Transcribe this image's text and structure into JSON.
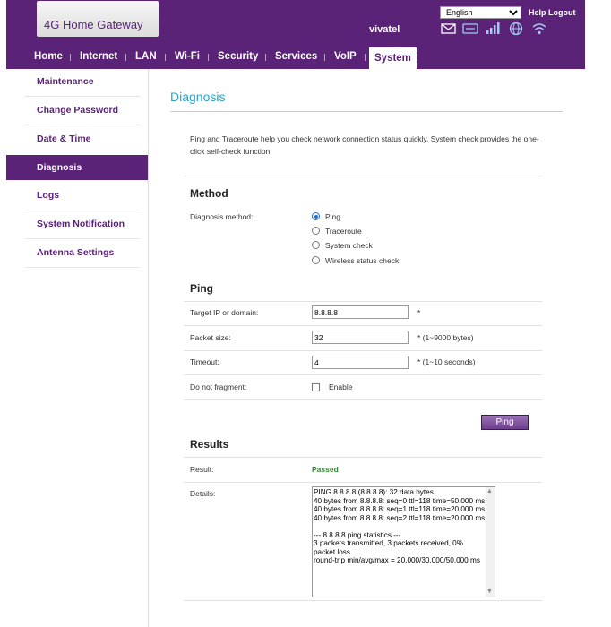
{
  "header": {
    "logo": "4G Home Gateway",
    "brand": "vivatel",
    "language": "English",
    "help": "Help",
    "logout": "Logout"
  },
  "nav": [
    "Home",
    "Internet",
    "LAN",
    "Wi-Fi",
    "Security",
    "Services",
    "VoIP",
    "System"
  ],
  "sidebar": [
    "Maintenance",
    "Change Password",
    "Date & Time",
    "Diagnosis",
    "Logs",
    "System Notification",
    "Antenna Settings"
  ],
  "page": {
    "title": "Diagnosis",
    "intro": "Ping and Traceroute help you check network connection status quickly. System check provides the one-click self-check function."
  },
  "method": {
    "heading": "Method",
    "label": "Diagnosis method:",
    "options": [
      "Ping",
      "Traceroute",
      "System check",
      "Wireless status check"
    ],
    "selected": "Ping"
  },
  "ping": {
    "heading": "Ping",
    "target_label": "Target IP or domain:",
    "target_value": "8.8.8.8",
    "target_hint": "*",
    "size_label": "Packet size:",
    "size_value": "32",
    "size_hint": "* (1~9000 bytes)",
    "timeout_label": "Timeout:",
    "timeout_value": "4",
    "timeout_hint": "* (1~10 seconds)",
    "fragment_label": "Do not fragment:",
    "fragment_option": "Enable",
    "button": "Ping"
  },
  "results": {
    "heading": "Results",
    "result_label": "Result:",
    "result_value": "Passed",
    "details_label": "Details:",
    "details_text": "PING 8.8.8.8 (8.8.8.8): 32 data bytes\n40 bytes from 8.8.8.8: seq=0 ttl=118 time=50.000 ms\n40 bytes from 8.8.8.8: seq=1 ttl=118 time=20.000 ms\n40 bytes from 8.8.8.8: seq=2 ttl=118 time=20.000 ms\n\n--- 8.8.8.8 ping statistics ---\n3 packets transmitted, 3 packets received, 0% packet loss\nround-trip min/avg/max = 20.000/30.000/50.000 ms"
  },
  "colors": {
    "brand_purple": "#5b2378",
    "title_blue": "#29a3c9",
    "passed_green": "#2e8b2e"
  }
}
